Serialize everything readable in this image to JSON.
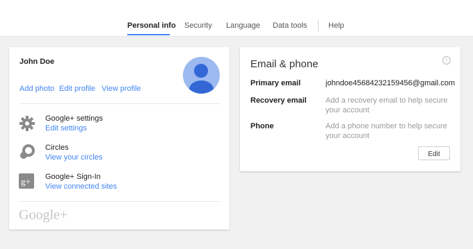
{
  "nav": {
    "tabs": [
      {
        "label": "Personal info"
      },
      {
        "label": "Security"
      },
      {
        "label": "Language"
      },
      {
        "label": "Data tools"
      },
      {
        "label": "Help"
      }
    ],
    "active_tab": "Personal info"
  },
  "profile": {
    "name": "John Doe",
    "add_photo": "Add photo",
    "edit_profile": "Edit profile",
    "view_profile": "View profile",
    "avatar_icon": "person-avatar-icon"
  },
  "links": [
    {
      "title": "Google+ settings",
      "link": "Edit settings",
      "icon": "gear-icon"
    },
    {
      "title": "Circles",
      "link": "View your circles",
      "icon": "circles-icon"
    },
    {
      "title": "Google+ Sign-In",
      "link": "View connected sites",
      "icon": "google-plus-icon"
    }
  ],
  "brand": {
    "logo_text": "Google+"
  },
  "contact": {
    "title": "Email & phone",
    "primary_email_label": "Primary email",
    "primary_email_value": "johndoe45684232159456@gmail.com",
    "recovery_email_label": "Recovery email",
    "recovery_email_hint": "Add a recovery email to help secure your account",
    "phone_label": "Phone",
    "phone_hint": "Add a phone number to help secure your account",
    "edit_label": "Edit",
    "info_icon": "info-icon"
  },
  "colors": {
    "accent": "#4285f4",
    "avatar_bg": "#9cb9f0",
    "avatar_fg": "#3367d6"
  }
}
